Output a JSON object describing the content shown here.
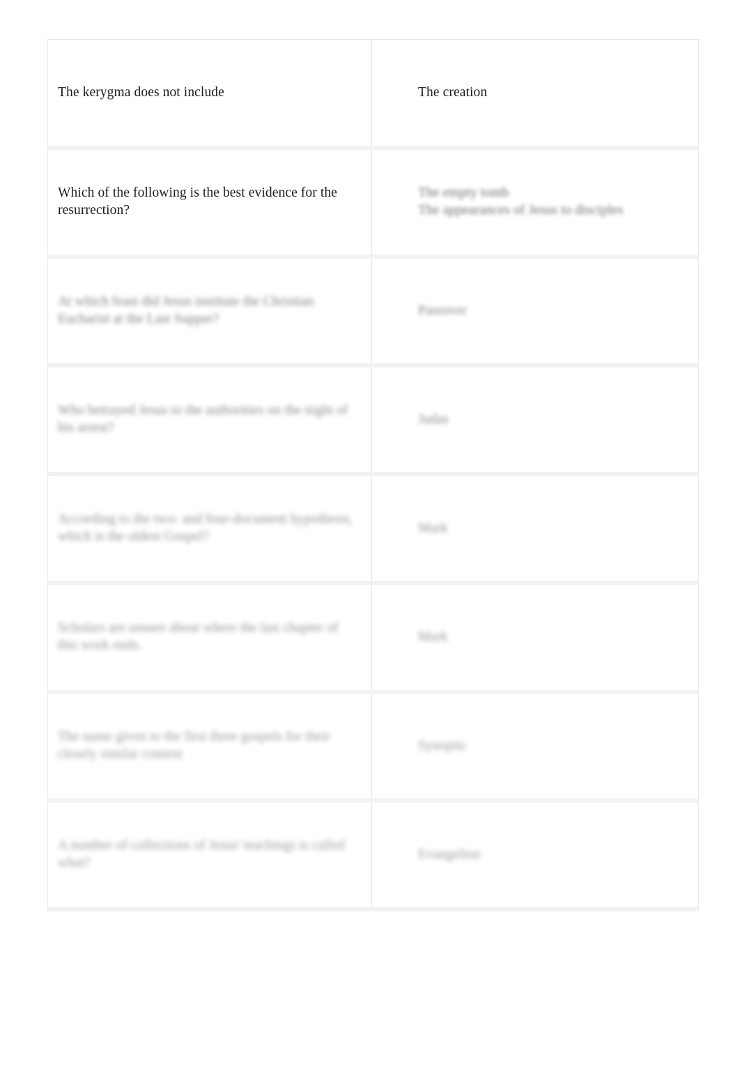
{
  "document": {
    "type": "flashcard-table",
    "column_count": 2,
    "row_count": 8,
    "background_color": "#ffffff",
    "text_color": "#1c1c1c",
    "border_color": "#e4e4e4",
    "gutter_color": "#f2f2f2"
  },
  "rows": [
    {
      "term": "The kerygma does not include",
      "definition": "The creation",
      "term_blur": 0,
      "definition_blur": 0
    },
    {
      "term": "Which of the following is the best evidence for the resurrection?",
      "definition": "The empty tomb\nThe appearances of Jesus to disciples",
      "term_blur": 0,
      "definition_blur": 2
    },
    {
      "term": "At which feast did Jesus institute the Christian Eucharist at the Last Supper?",
      "definition": "Passover",
      "term_blur": 3,
      "definition_blur": 3
    },
    {
      "term": "Who betrayed Jesus to the authorities on the night of his arrest?",
      "definition": "Judas",
      "term_blur": 4,
      "definition_blur": 4
    },
    {
      "term": "According to the two- and four-document hypothesis, which is the oldest Gospel?",
      "definition": "Mark",
      "term_blur": 5,
      "definition_blur": 5
    },
    {
      "term": "Scholars are unsure about where the last chapter of this work ends.",
      "definition": "Mark",
      "term_blur": 6,
      "definition_blur": 6
    },
    {
      "term": "The name given to the first three gospels for their closely similar content",
      "definition": "Synoptic",
      "term_blur": 7,
      "definition_blur": 7
    },
    {
      "term": "A number of collections of Jesus' teachings is called what?",
      "definition": "Evangelion",
      "term_blur": 7,
      "definition_blur": 7
    }
  ]
}
